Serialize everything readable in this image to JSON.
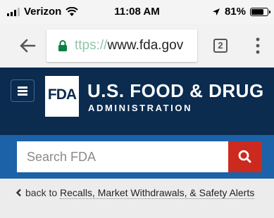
{
  "status_bar": {
    "carrier": "Verizon",
    "time": "11:08 AM",
    "battery": "81%",
    "battery_level": 0.81,
    "icons": [
      "signal-icon",
      "wifi-icon",
      "location-arrow-icon",
      "battery-icon"
    ]
  },
  "browser": {
    "url_scheme": "ttps://",
    "url_host": "www.fda.gov",
    "tab_count": "2",
    "icons": [
      "back-arrow-icon",
      "lock-icon",
      "tab-switcher-icon",
      "overflow-menu-icon"
    ]
  },
  "header": {
    "logo_text": "FDA",
    "agency_name": "U.S. FOOD & DRUG",
    "agency_subtitle": "ADMINISTRATION"
  },
  "search": {
    "placeholder": "Search FDA"
  },
  "breadcrumb": {
    "prefix": "back to",
    "link_text": "Recalls, Market Withdrawals, & Safety Alerts"
  },
  "colors": {
    "header_navy": "#0b2b4f",
    "search_blue": "#1c62a8",
    "search_button_red": "#cc2a1e",
    "lock_green": "#0b8043"
  }
}
